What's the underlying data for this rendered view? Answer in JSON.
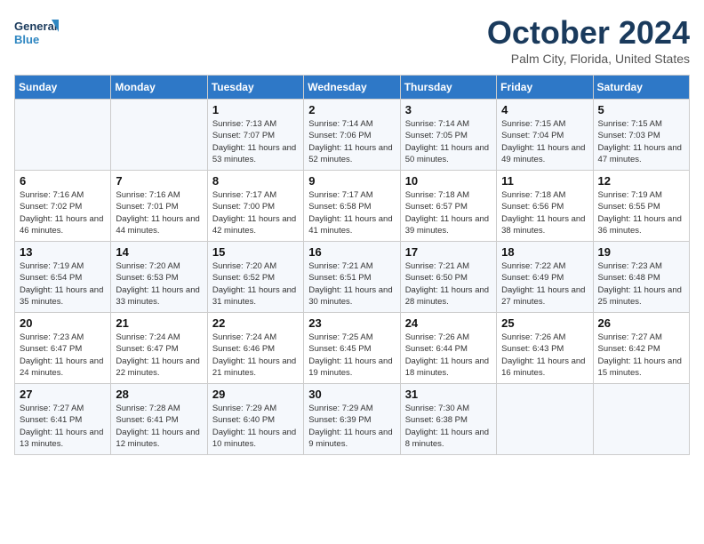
{
  "logo": {
    "line1": "General",
    "line2": "Blue"
  },
  "title": "October 2024",
  "location": "Palm City, Florida, United States",
  "days_of_week": [
    "Sunday",
    "Monday",
    "Tuesday",
    "Wednesday",
    "Thursday",
    "Friday",
    "Saturday"
  ],
  "weeks": [
    [
      {
        "num": "",
        "info": ""
      },
      {
        "num": "",
        "info": ""
      },
      {
        "num": "1",
        "info": "Sunrise: 7:13 AM\nSunset: 7:07 PM\nDaylight: 11 hours and 53 minutes."
      },
      {
        "num": "2",
        "info": "Sunrise: 7:14 AM\nSunset: 7:06 PM\nDaylight: 11 hours and 52 minutes."
      },
      {
        "num": "3",
        "info": "Sunrise: 7:14 AM\nSunset: 7:05 PM\nDaylight: 11 hours and 50 minutes."
      },
      {
        "num": "4",
        "info": "Sunrise: 7:15 AM\nSunset: 7:04 PM\nDaylight: 11 hours and 49 minutes."
      },
      {
        "num": "5",
        "info": "Sunrise: 7:15 AM\nSunset: 7:03 PM\nDaylight: 11 hours and 47 minutes."
      }
    ],
    [
      {
        "num": "6",
        "info": "Sunrise: 7:16 AM\nSunset: 7:02 PM\nDaylight: 11 hours and 46 minutes."
      },
      {
        "num": "7",
        "info": "Sunrise: 7:16 AM\nSunset: 7:01 PM\nDaylight: 11 hours and 44 minutes."
      },
      {
        "num": "8",
        "info": "Sunrise: 7:17 AM\nSunset: 7:00 PM\nDaylight: 11 hours and 42 minutes."
      },
      {
        "num": "9",
        "info": "Sunrise: 7:17 AM\nSunset: 6:58 PM\nDaylight: 11 hours and 41 minutes."
      },
      {
        "num": "10",
        "info": "Sunrise: 7:18 AM\nSunset: 6:57 PM\nDaylight: 11 hours and 39 minutes."
      },
      {
        "num": "11",
        "info": "Sunrise: 7:18 AM\nSunset: 6:56 PM\nDaylight: 11 hours and 38 minutes."
      },
      {
        "num": "12",
        "info": "Sunrise: 7:19 AM\nSunset: 6:55 PM\nDaylight: 11 hours and 36 minutes."
      }
    ],
    [
      {
        "num": "13",
        "info": "Sunrise: 7:19 AM\nSunset: 6:54 PM\nDaylight: 11 hours and 35 minutes."
      },
      {
        "num": "14",
        "info": "Sunrise: 7:20 AM\nSunset: 6:53 PM\nDaylight: 11 hours and 33 minutes."
      },
      {
        "num": "15",
        "info": "Sunrise: 7:20 AM\nSunset: 6:52 PM\nDaylight: 11 hours and 31 minutes."
      },
      {
        "num": "16",
        "info": "Sunrise: 7:21 AM\nSunset: 6:51 PM\nDaylight: 11 hours and 30 minutes."
      },
      {
        "num": "17",
        "info": "Sunrise: 7:21 AM\nSunset: 6:50 PM\nDaylight: 11 hours and 28 minutes."
      },
      {
        "num": "18",
        "info": "Sunrise: 7:22 AM\nSunset: 6:49 PM\nDaylight: 11 hours and 27 minutes."
      },
      {
        "num": "19",
        "info": "Sunrise: 7:23 AM\nSunset: 6:48 PM\nDaylight: 11 hours and 25 minutes."
      }
    ],
    [
      {
        "num": "20",
        "info": "Sunrise: 7:23 AM\nSunset: 6:47 PM\nDaylight: 11 hours and 24 minutes."
      },
      {
        "num": "21",
        "info": "Sunrise: 7:24 AM\nSunset: 6:47 PM\nDaylight: 11 hours and 22 minutes."
      },
      {
        "num": "22",
        "info": "Sunrise: 7:24 AM\nSunset: 6:46 PM\nDaylight: 11 hours and 21 minutes."
      },
      {
        "num": "23",
        "info": "Sunrise: 7:25 AM\nSunset: 6:45 PM\nDaylight: 11 hours and 19 minutes."
      },
      {
        "num": "24",
        "info": "Sunrise: 7:26 AM\nSunset: 6:44 PM\nDaylight: 11 hours and 18 minutes."
      },
      {
        "num": "25",
        "info": "Sunrise: 7:26 AM\nSunset: 6:43 PM\nDaylight: 11 hours and 16 minutes."
      },
      {
        "num": "26",
        "info": "Sunrise: 7:27 AM\nSunset: 6:42 PM\nDaylight: 11 hours and 15 minutes."
      }
    ],
    [
      {
        "num": "27",
        "info": "Sunrise: 7:27 AM\nSunset: 6:41 PM\nDaylight: 11 hours and 13 minutes."
      },
      {
        "num": "28",
        "info": "Sunrise: 7:28 AM\nSunset: 6:41 PM\nDaylight: 11 hours and 12 minutes."
      },
      {
        "num": "29",
        "info": "Sunrise: 7:29 AM\nSunset: 6:40 PM\nDaylight: 11 hours and 10 minutes."
      },
      {
        "num": "30",
        "info": "Sunrise: 7:29 AM\nSunset: 6:39 PM\nDaylight: 11 hours and 9 minutes."
      },
      {
        "num": "31",
        "info": "Sunrise: 7:30 AM\nSunset: 6:38 PM\nDaylight: 11 hours and 8 minutes."
      },
      {
        "num": "",
        "info": ""
      },
      {
        "num": "",
        "info": ""
      }
    ]
  ]
}
